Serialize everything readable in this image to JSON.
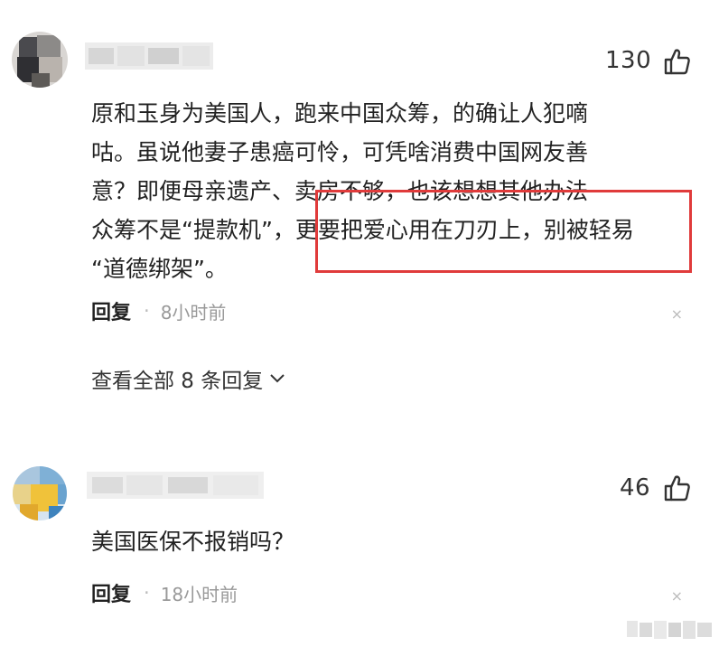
{
  "comments": [
    {
      "likes": "130",
      "lines": [
        "原和玉身为美国人，跑来中国众筹，的确让人犯嘀",
        "咕。虽说他妻子患癌可怜，可凭啥消费中国网友善",
        "意？即便母亲遗产、卖房不够，也该想想其他办法",
        "众筹不是“提款机”，更要把爱心用在刀刃上，别被轻易",
        "“道德绑架”。"
      ],
      "reply_label": "回复",
      "time": "8小时前",
      "view_replies": "查看全部 8 条回复"
    },
    {
      "likes": "46",
      "lines": [
        "美国医保不报销吗？"
      ],
      "reply_label": "回复",
      "time": "18小时前"
    }
  ],
  "icons": {
    "like": "thumbs-up-icon",
    "close": "close-icon",
    "chevron": "chevron-down-icon"
  },
  "colors": {
    "highlight_box": "#e03b3b",
    "text": "#222222",
    "muted": "#999999"
  },
  "close_glyph": "×"
}
